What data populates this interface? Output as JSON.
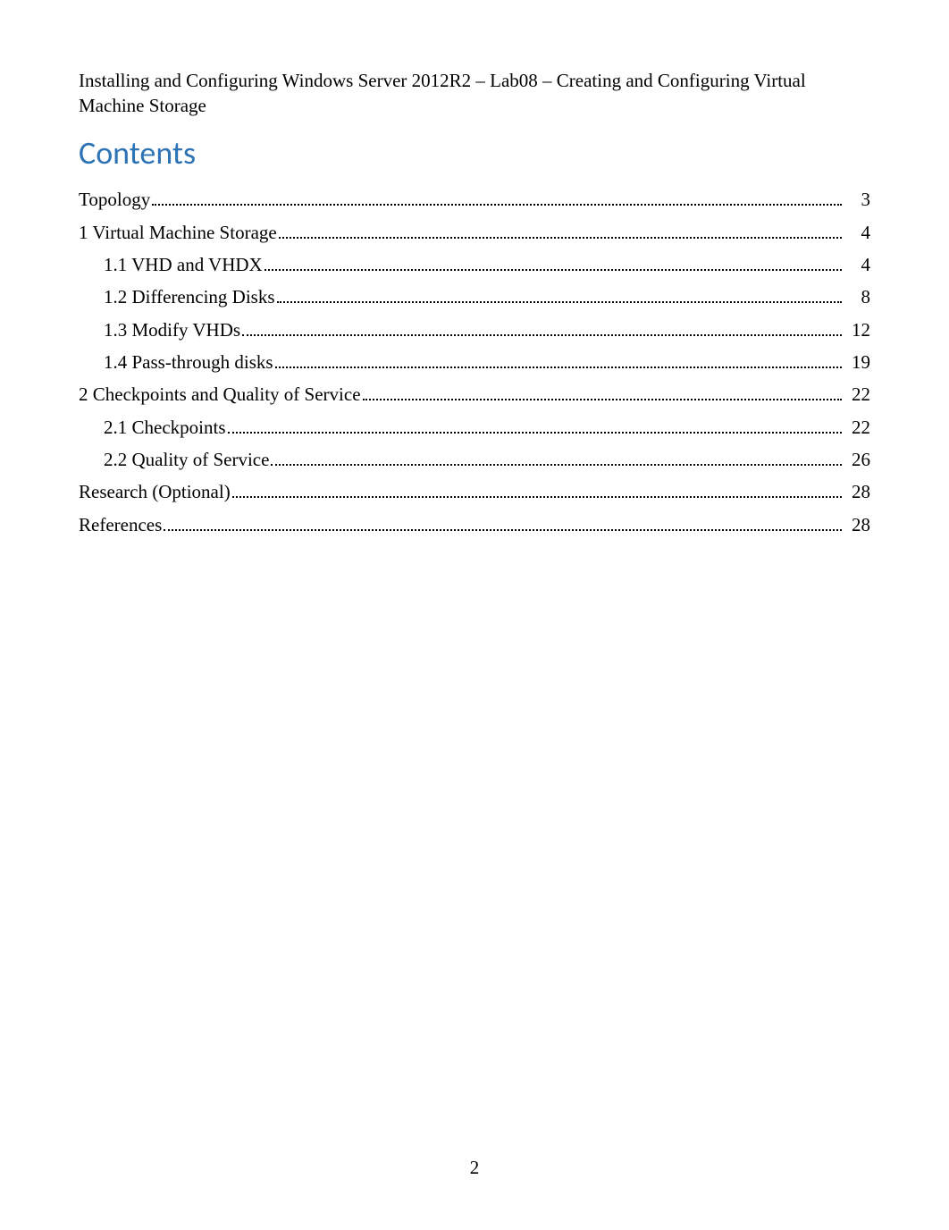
{
  "header": {
    "text": "Installing and Configuring Windows Server 2012R2 – Lab08 – Creating and Configuring Virtual Machine Storage"
  },
  "contents_title": "Contents",
  "toc": [
    {
      "label": "Topology",
      "page": "3",
      "level": 1
    },
    {
      "label": "1 Virtual Machine Storage",
      "page": "4",
      "level": 1
    },
    {
      "label": "1.1 VHD and VHDX",
      "page": "4",
      "level": 2
    },
    {
      "label": "1.2 Differencing Disks",
      "page": "8",
      "level": 2
    },
    {
      "label": "1.3 Modify VHDs",
      "page": "12",
      "level": 2
    },
    {
      "label": "1.4 Pass-through disks",
      "page": "19",
      "level": 2
    },
    {
      "label": "2 Checkpoints and Quality of Service",
      "page": "22",
      "level": 1
    },
    {
      "label": "2.1 Checkpoints",
      "page": "22",
      "level": 2
    },
    {
      "label": "2.2 Quality of Service",
      "page": "26",
      "level": 2
    },
    {
      "label": "Research (Optional)",
      "page": "28",
      "level": 1
    },
    {
      "label": "References",
      "page": "28",
      "level": 1
    }
  ],
  "page_number": "2"
}
